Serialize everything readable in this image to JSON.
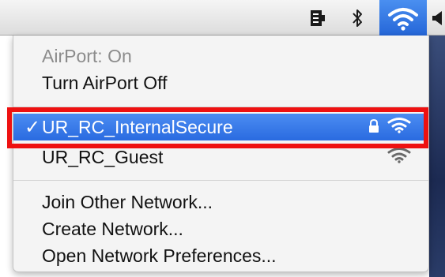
{
  "menubar": {
    "icons": {
      "battery": "battery-icon",
      "bluetooth": "bluetooth-icon",
      "wifi": "wifi-icon",
      "volume": "volume-icon"
    }
  },
  "menu": {
    "status_label": "AirPort: On",
    "toggle_label": "Turn AirPort Off",
    "networks": [
      {
        "name": "UR_RC_InternalSecure",
        "connected": true,
        "secured": true,
        "check": "✓"
      },
      {
        "name": "UR_RC_Guest",
        "connected": false,
        "secured": false
      }
    ],
    "join_label": "Join Other Network...",
    "create_label": "Create Network...",
    "prefs_label": "Open Network Preferences..."
  },
  "colors": {
    "selection": "#2a6be0",
    "highlight_box": "#ee1111",
    "disabled_text": "#8c8c8c"
  }
}
